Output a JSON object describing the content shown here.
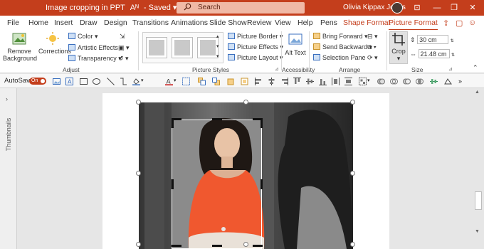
{
  "titlebar": {
    "doc_title": "Image cropping in PPT",
    "sensitivity": "Aᴺ",
    "saved": "Saved",
    "search_placeholder": "Search",
    "user_name": "Olivia Kippax Jones"
  },
  "tabs": [
    "File",
    "Home",
    "Insert",
    "Draw",
    "Design",
    "Transitions",
    "Animations",
    "Slide Show",
    "Review",
    "View",
    "Help",
    "Pens",
    "Shape Format",
    "Picture Format"
  ],
  "active_tab": "Picture Format",
  "ribbon": {
    "adjust": {
      "remove_background": "Remove Background",
      "corrections": "Corrections",
      "color": "Color",
      "artistic_effects": "Artistic Effects",
      "transparency": "Transparency",
      "group_label": "Adjust"
    },
    "picture_styles": {
      "picture_border": "Picture Border",
      "picture_effects": "Picture Effects",
      "picture_layout": "Picture Layout",
      "group_label": "Picture Styles"
    },
    "accessibility": {
      "alt_text": "Alt Text",
      "group_label": "Accessibility"
    },
    "arrange": {
      "bring_forward": "Bring Forward",
      "send_backward": "Send Backward",
      "selection_pane": "Selection Pane",
      "group_label": "Arrange"
    },
    "size": {
      "crop": "Crop",
      "height": "30 cm",
      "width": "21.48 cm",
      "group_label": "Size"
    }
  },
  "quick_toolbar": {
    "autosave_label": "AutoSave",
    "autosave_state": "On"
  },
  "thumbnails_label": "Thumbnails",
  "colors": {
    "accent": "#c43e1c"
  }
}
